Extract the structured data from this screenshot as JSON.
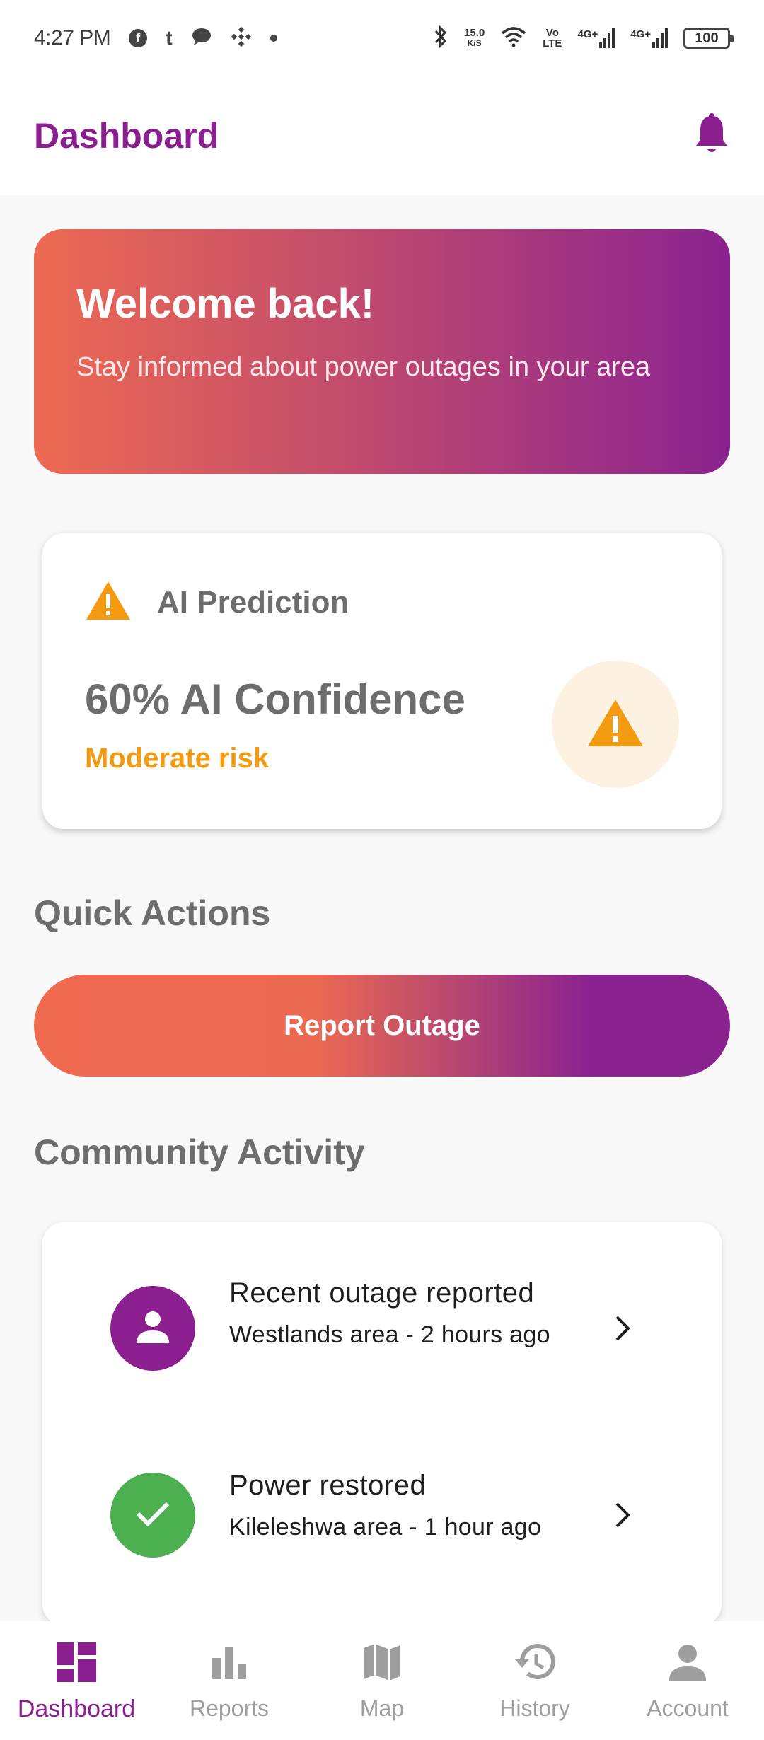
{
  "status_bar": {
    "time": "4:27 PM",
    "speed_value": "15.0",
    "speed_unit": "K/S",
    "volte_top": "Vo",
    "volte_bottom": "LTE",
    "net1": "4G+",
    "net2": "4G+",
    "battery": "100"
  },
  "app_bar": {
    "title": "Dashboard"
  },
  "welcome": {
    "title": "Welcome back!",
    "subtitle": "Stay informed about power outages in your area"
  },
  "prediction": {
    "label": "AI Prediction",
    "confidence": "60% AI Confidence",
    "risk": "Moderate risk"
  },
  "quick_actions": {
    "title": "Quick Actions",
    "report_button": "Report Outage"
  },
  "community": {
    "title": "Community Activity",
    "items": [
      {
        "title": "Recent outage reported",
        "subtitle": "Westlands area - 2 hours ago",
        "icon": "person-icon"
      },
      {
        "title": "Power restored",
        "subtitle": "Kileleshwa area - 1 hour ago",
        "icon": "check-icon"
      }
    ]
  },
  "bottom_nav": [
    {
      "label": "Dashboard",
      "icon": "dashboard-icon",
      "active": true
    },
    {
      "label": "Reports",
      "icon": "bar-chart-icon",
      "active": false
    },
    {
      "label": "Map",
      "icon": "map-icon",
      "active": false
    },
    {
      "label": "History",
      "icon": "history-icon",
      "active": false
    },
    {
      "label": "Account",
      "icon": "account-icon",
      "active": false
    }
  ],
  "colors": {
    "brand": "#8b1f90",
    "accent": "#ed6a52",
    "warning": "#f39a10",
    "success": "#4caf50"
  }
}
